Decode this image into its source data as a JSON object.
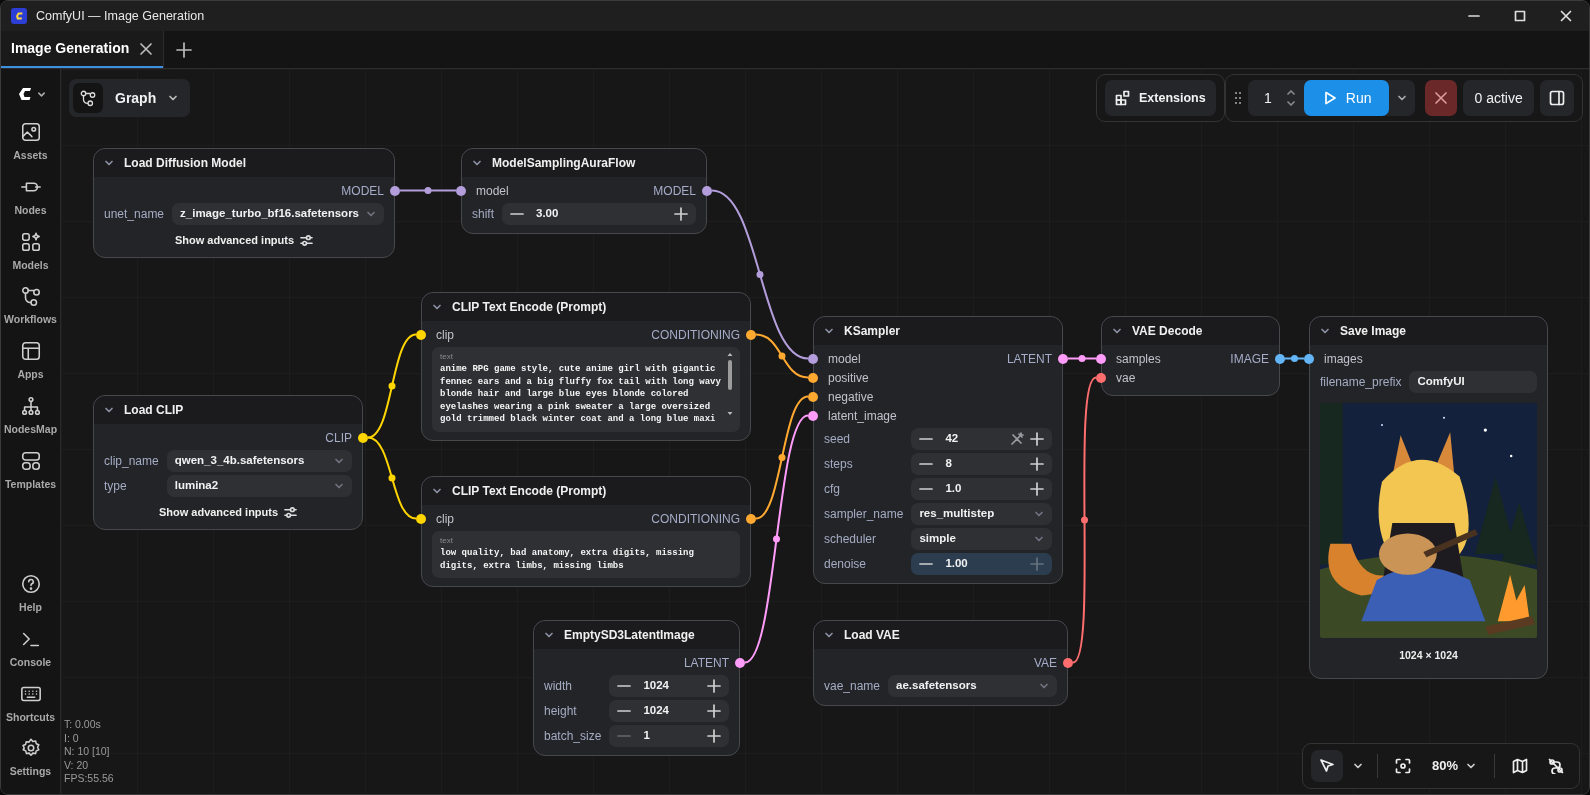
{
  "window": {
    "title": "ComfyUI — Image Generation"
  },
  "tabs": [
    {
      "label": "Image Generation",
      "selected": true
    }
  ],
  "sidebar": {
    "items": [
      {
        "label": "Assets"
      },
      {
        "label": "Nodes"
      },
      {
        "label": "Models"
      },
      {
        "label": "Workflows"
      },
      {
        "label": "Apps"
      },
      {
        "label": "NodesMap"
      },
      {
        "label": "Templates"
      }
    ],
    "bottom_items": [
      {
        "label": "Help"
      },
      {
        "label": "Console"
      },
      {
        "label": "Shortcuts"
      },
      {
        "label": "Settings"
      }
    ]
  },
  "graph_menu": {
    "label": "Graph"
  },
  "toolbar": {
    "extensions": "Extensions",
    "batch_count": "1",
    "run": "Run",
    "queue": "0 active"
  },
  "nodes": [
    {
      "title": "Load Diffusion Model",
      "outputs": [
        {
          "label": "MODEL",
          "color": "#b39ddb"
        }
      ],
      "widgets": [
        {
          "kind": "combo",
          "label": "unet_name",
          "value": "z_image_turbo_bf16.safetensors"
        }
      ],
      "footer": "Show advanced inputs"
    },
    {
      "title": "ModelSamplingAuraFlow",
      "inputs": [
        {
          "label": "model",
          "color": "#b39ddb"
        }
      ],
      "outputs": [
        {
          "label": "MODEL",
          "color": "#b39ddb"
        }
      ],
      "widgets": [
        {
          "kind": "number",
          "label": "shift",
          "value": "3.00",
          "randomize": false,
          "highlighted": false,
          "min_reached": false,
          "max_reached": false
        }
      ]
    },
    {
      "title": "CLIP Text Encode (Prompt)",
      "inputs": [
        {
          "label": "clip",
          "color": "#ffd500"
        }
      ],
      "outputs": [
        {
          "label": "CONDITIONING",
          "color": "#ffa931"
        }
      ],
      "widgets": [
        {
          "kind": "textarea",
          "label": "text",
          "value": "anime RPG game style, cute anime girl with gigantic fennec ears and a big fluffy fox tail with long wavy blonde hair and large blue eyes blonde colored eyelashes wearing a pink sweater a large oversized gold trimmed black winter coat and a long blue maxi",
          "scrollable": true
        }
      ]
    },
    {
      "title": "Load CLIP",
      "outputs": [
        {
          "label": "CLIP",
          "color": "#ffd500"
        }
      ],
      "widgets": [
        {
          "kind": "combo",
          "label": "clip_name",
          "value": "qwen_3_4b.safetensors"
        },
        {
          "kind": "combo",
          "label": "type",
          "value": "lumina2"
        }
      ],
      "footer": "Show advanced inputs"
    },
    {
      "title": "CLIP Text Encode (Prompt)",
      "inputs": [
        {
          "label": "clip",
          "color": "#ffd500"
        }
      ],
      "outputs": [
        {
          "label": "CONDITIONING",
          "color": "#ffa931"
        }
      ],
      "widgets": [
        {
          "kind": "textarea",
          "label": "text",
          "value": "low quality, bad anatomy, extra digits, missing digits, extra limbs, missing limbs",
          "scrollable": false
        }
      ]
    },
    {
      "title": "EmptySD3LatentImage",
      "outputs": [
        {
          "label": "LATENT",
          "color": "#ff9cf9"
        }
      ],
      "widgets": [
        {
          "kind": "number",
          "label": "width",
          "value": "1024",
          "randomize": false,
          "highlighted": false,
          "min_reached": false,
          "max_reached": false
        },
        {
          "kind": "number",
          "label": "height",
          "value": "1024",
          "randomize": false,
          "highlighted": false,
          "min_reached": false,
          "max_reached": false
        },
        {
          "kind": "number",
          "label": "batch_size",
          "value": "1",
          "randomize": false,
          "highlighted": false,
          "min_reached": true,
          "max_reached": false
        }
      ]
    },
    {
      "title": "KSampler",
      "inputs": [
        {
          "label": "model",
          "color": "#b39ddb"
        },
        {
          "label": "positive",
          "color": "#ffa931"
        },
        {
          "label": "negative",
          "color": "#ffa931"
        },
        {
          "label": "latent_image",
          "color": "#ff9cf9"
        }
      ],
      "outputs": [
        {
          "label": "LATENT",
          "color": "#ff9cf9"
        }
      ],
      "widgets": [
        {
          "kind": "number",
          "label": "seed",
          "value": "42",
          "randomize": true,
          "highlighted": false,
          "min_reached": false,
          "max_reached": false
        },
        {
          "kind": "number",
          "label": "steps",
          "value": "8",
          "randomize": false,
          "highlighted": false,
          "min_reached": false,
          "max_reached": false
        },
        {
          "kind": "number",
          "label": "cfg",
          "value": "1.0",
          "randomize": false,
          "highlighted": false,
          "min_reached": false,
          "max_reached": false
        },
        {
          "kind": "combo",
          "label": "sampler_name",
          "value": "res_multistep"
        },
        {
          "kind": "combo",
          "label": "scheduler",
          "value": "simple"
        },
        {
          "kind": "number",
          "label": "denoise",
          "value": "1.00",
          "randomize": false,
          "highlighted": true,
          "min_reached": false,
          "max_reached": true
        }
      ]
    },
    {
      "title": "Load VAE",
      "outputs": [
        {
          "label": "VAE",
          "color": "#ff6e6e"
        }
      ],
      "widgets": [
        {
          "kind": "combo",
          "label": "vae_name",
          "value": "ae.safetensors"
        }
      ]
    },
    {
      "title": "VAE Decode",
      "inputs": [
        {
          "label": "samples",
          "color": "#ff9cf9"
        },
        {
          "label": "vae",
          "color": "#ff6e6e"
        }
      ],
      "outputs": [
        {
          "label": "IMAGE",
          "color": "#64b5f6"
        }
      ]
    },
    {
      "title": "Save Image",
      "inputs": [
        {
          "label": "images",
          "color": "#64b5f6"
        }
      ],
      "widgets": [
        {
          "kind": "text",
          "label": "filename_prefix",
          "value": "ComfyUI"
        }
      ],
      "preview": {
        "kind": "picture",
        "caption": "1024 × 1024"
      }
    }
  ],
  "stats": [
    "T: 0.00s",
    "I: 0",
    "N: 10 [10]",
    "V: 20",
    "FPS:55.56"
  ],
  "canvas_controls": {
    "pointer_selected": true,
    "zoom": "80%"
  }
}
